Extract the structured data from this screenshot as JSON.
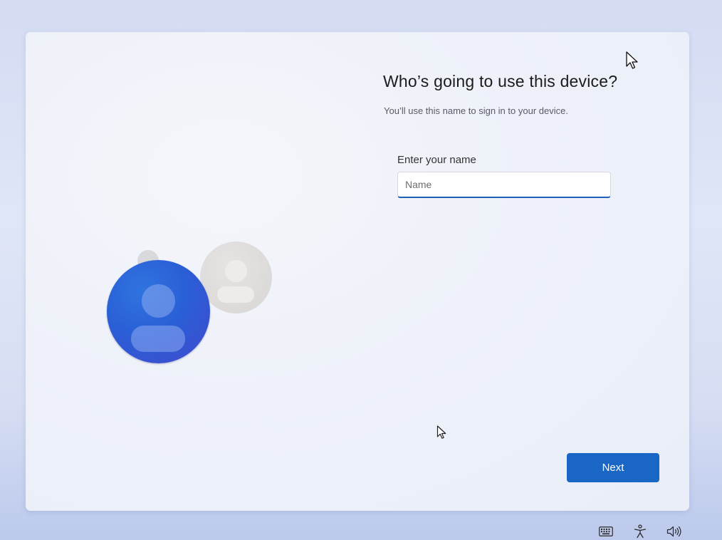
{
  "oobe": {
    "title": "Who’s going to use this device?",
    "subtitle": "You’ll use this name to sign in to your device.",
    "name_label": "Enter your name",
    "name_placeholder": "Name",
    "name_value": "",
    "next_label": "Next"
  },
  "illustration": {
    "primary_avatar_color": "#2a5fd6",
    "secondary_avatar_color": "#dcdad8"
  },
  "tray": {
    "icons": [
      "keyboard-icon",
      "accessibility-icon",
      "volume-icon"
    ]
  },
  "colors": {
    "accent": "#1a66c4",
    "input_focus": "#1f5fb4"
  }
}
